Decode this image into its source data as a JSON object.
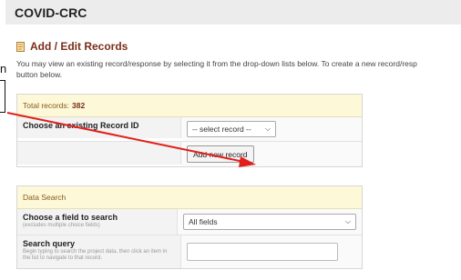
{
  "project": {
    "title": "COVID-CRC"
  },
  "section": {
    "title": "Add / Edit Records"
  },
  "intro": {
    "line1": "You may view an existing record/response by selecting it from the drop-down lists below. To create a new record/resp",
    "line2": "button below."
  },
  "side_text": "n",
  "records_panel": {
    "total_label": "Total records:",
    "total_count": "382",
    "choose_label": "Choose an existing Record ID",
    "select_value": "-- select record --",
    "add_button": "Add new record"
  },
  "search_panel": {
    "title": "Data Search",
    "field_label": "Choose a field to search",
    "field_sub": "(excludes multiple choice fields)",
    "field_value": "All fields",
    "query_label": "Search query",
    "query_sub": "Begin typing to search the project data, then click an item in the list to navigate to that record.",
    "query_value": ""
  },
  "colors": {
    "annotation_arrow": "#e0201b",
    "panel_header_bg": "#fcf8d8",
    "title": "#7b2d1b"
  },
  "icons": {
    "section": "edit-records-icon",
    "dropdown": "chevron-down-icon"
  }
}
